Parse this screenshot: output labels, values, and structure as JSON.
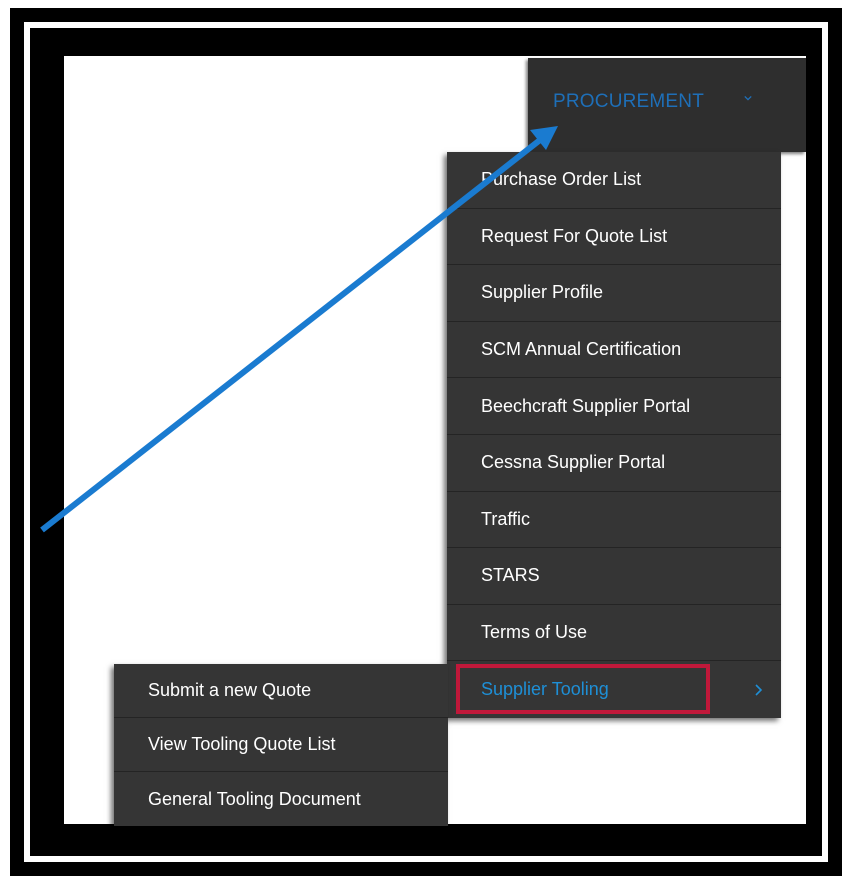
{
  "nav": {
    "label": "PROCUREMENT"
  },
  "menu": {
    "items": [
      {
        "label": "Purchase Order List"
      },
      {
        "label": "Request For Quote List"
      },
      {
        "label": "Supplier Profile"
      },
      {
        "label": "SCM Annual Certification"
      },
      {
        "label": "Beechcraft Supplier Portal"
      },
      {
        "label": "Cessna Supplier Portal"
      },
      {
        "label": "Traffic"
      },
      {
        "label": "STARS"
      },
      {
        "label": "Terms of Use"
      },
      {
        "label": "Supplier Tooling"
      }
    ]
  },
  "submenu": {
    "items": [
      {
        "label": "Submit a new Quote"
      },
      {
        "label": "View Tooling Quote List"
      },
      {
        "label": "General Tooling Document"
      }
    ]
  },
  "colors": {
    "menu_bg": "#353535",
    "accent_blue": "#1e8fd6",
    "highlight_red": "#c0183a",
    "annotation_arrow": "#1a7bd0"
  }
}
